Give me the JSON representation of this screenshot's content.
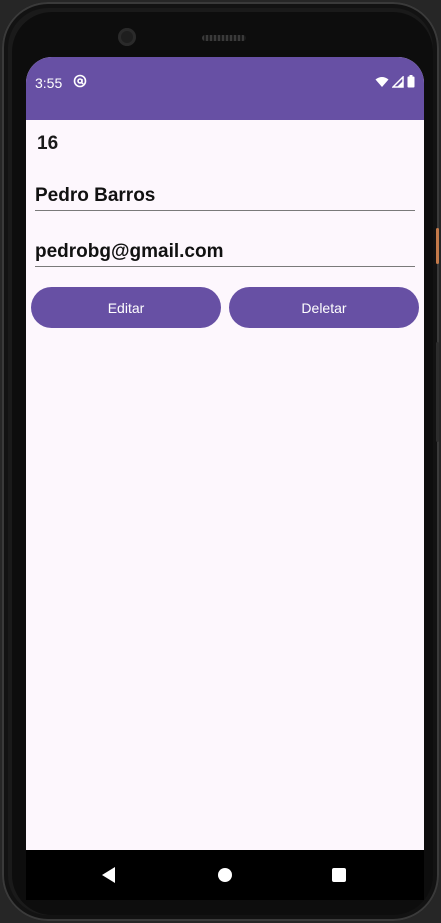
{
  "status_bar": {
    "time": "3:55",
    "app_icon": "at-sign-icon",
    "icons": [
      "wifi-icon",
      "signal-icon",
      "battery-icon"
    ],
    "background": "#6750a4"
  },
  "record": {
    "id": "16",
    "name": "Pedro Barros",
    "email": "pedrobg@gmail.com"
  },
  "buttons": {
    "edit_label": "Editar",
    "delete_label": "Deletar",
    "color": "#6750a4"
  },
  "nav_bar": {
    "icons": [
      "back-icon",
      "home-icon",
      "recents-icon"
    ]
  }
}
